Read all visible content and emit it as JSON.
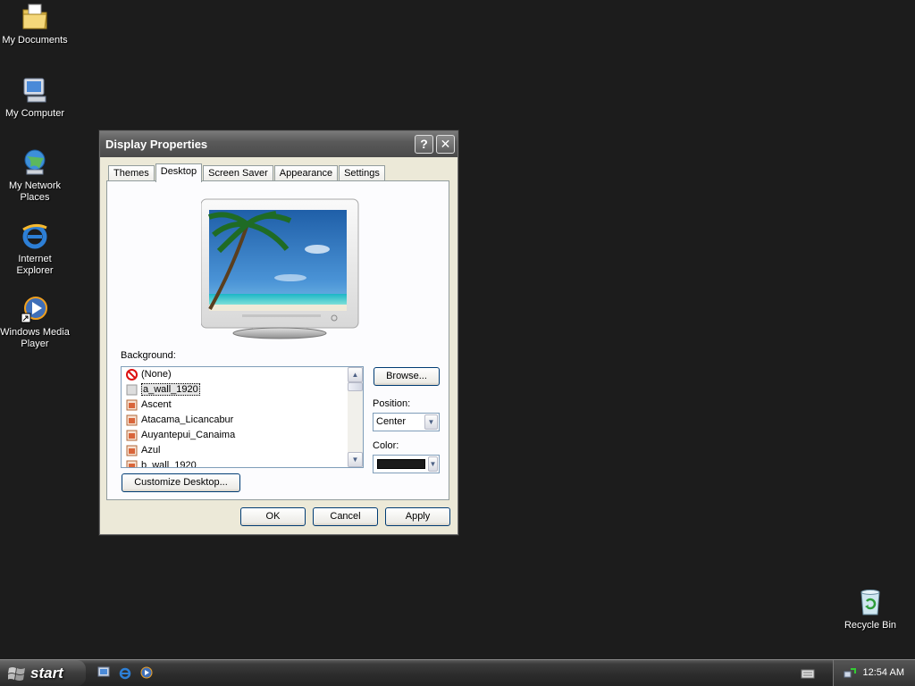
{
  "desktop": {
    "icons": [
      {
        "label": "My Documents"
      },
      {
        "label": "My Computer"
      },
      {
        "label": "My Network Places"
      },
      {
        "label": "Internet Explorer"
      },
      {
        "label": "Windows Media Player"
      },
      {
        "label": "Recycle Bin"
      }
    ]
  },
  "window": {
    "title": "Display Properties",
    "help_glyph": "?",
    "close_glyph": "✕",
    "tabs": [
      {
        "label": "Themes"
      },
      {
        "label": "Desktop"
      },
      {
        "label": "Screen Saver"
      },
      {
        "label": "Appearance"
      },
      {
        "label": "Settings"
      }
    ],
    "background_label": "Background:",
    "background_items": [
      {
        "label": "(None)",
        "icon": "none-icon"
      },
      {
        "label": "a_wall_1920",
        "icon": "image-file-icon"
      },
      {
        "label": "Ascent",
        "icon": "image-file-icon"
      },
      {
        "label": "Atacama_Licancabur",
        "icon": "image-file-icon"
      },
      {
        "label": "Auyantepui_Canaima",
        "icon": "image-file-icon"
      },
      {
        "label": "Azul",
        "icon": "image-file-icon"
      },
      {
        "label": "b_wall_1920",
        "icon": "image-file-icon"
      }
    ],
    "browse_label": "Browse...",
    "position_label": "Position:",
    "position_value": "Center",
    "color_label": "Color:",
    "color_value": "#1a1a1a",
    "customize_label": "Customize Desktop...",
    "ok_label": "OK",
    "cancel_label": "Cancel",
    "apply_label": "Apply"
  },
  "taskbar": {
    "start_label": "start",
    "clock": "12:54 AM"
  }
}
